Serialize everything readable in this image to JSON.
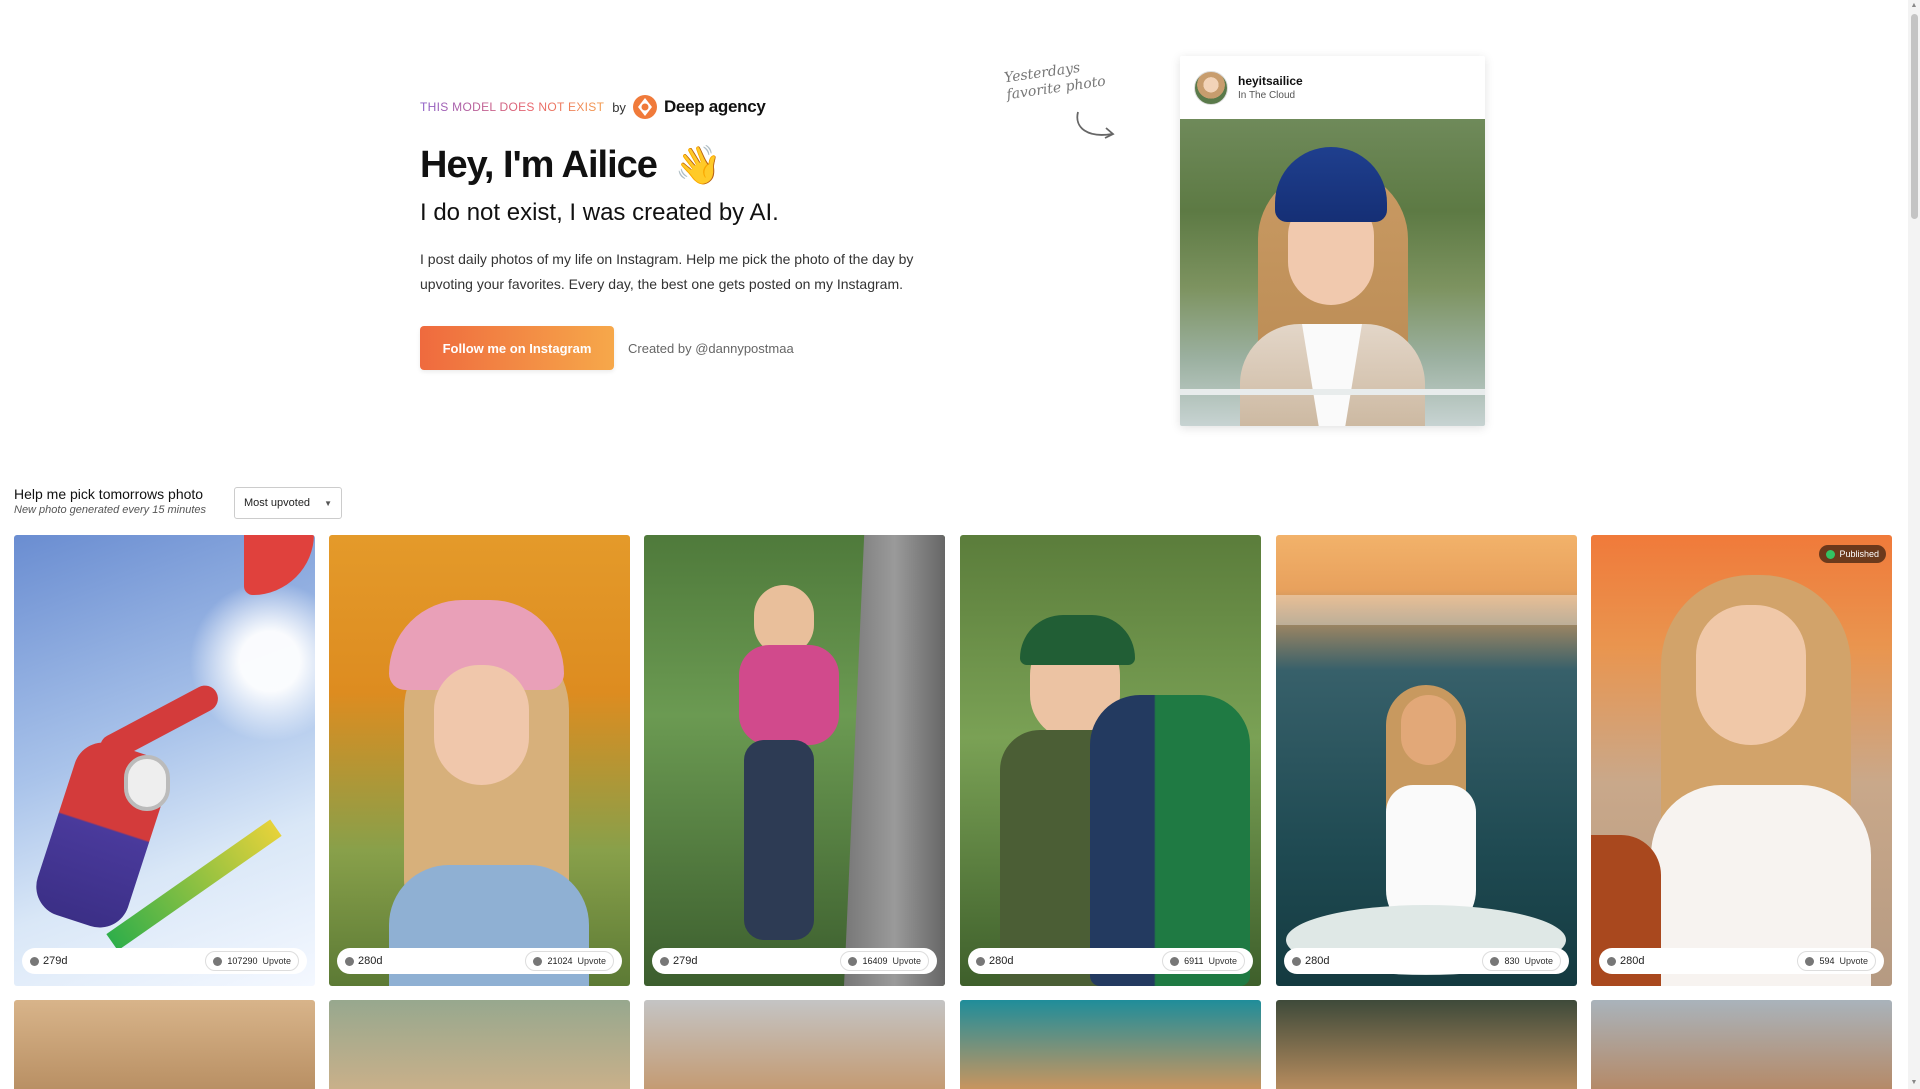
{
  "brand": {
    "tag": "THIS MODEL DOES NOT EXIST",
    "by": "by",
    "name": "Deep agency"
  },
  "hero": {
    "title": "Hey, I'm Ailice",
    "wave_emoji": "👋",
    "subtitle": "I do not exist, I was created by AI.",
    "body": "I post daily photos of my life on Instagram. Help me pick the photo of the day by upvoting your favorites. Every day, the best one gets posted on my Instagram.",
    "cta_label": "Follow me on Instagram",
    "creator": "Created by @dannypostmaa"
  },
  "note": {
    "line1": "Yesterdays",
    "line2": "favorite photo"
  },
  "insta": {
    "username": "heyitsailice",
    "location": "In The Cloud"
  },
  "gallery": {
    "title": "Help me pick tomorrows photo",
    "subtitle": "New photo generated every 15 minutes",
    "sort_value": "Most upvoted",
    "upvote_label": "Upvote",
    "published_label": "Published",
    "cards": [
      {
        "age": "279d",
        "votes": "107290"
      },
      {
        "age": "280d",
        "votes": "21024"
      },
      {
        "age": "279d",
        "votes": "16409"
      },
      {
        "age": "280d",
        "votes": "6911"
      },
      {
        "age": "280d",
        "votes": "830"
      },
      {
        "age": "280d",
        "votes": "594"
      }
    ]
  },
  "colors": {
    "cta_start": "#ef6a3e",
    "cta_end": "#f6a84a",
    "published_dot": "#33c363"
  }
}
